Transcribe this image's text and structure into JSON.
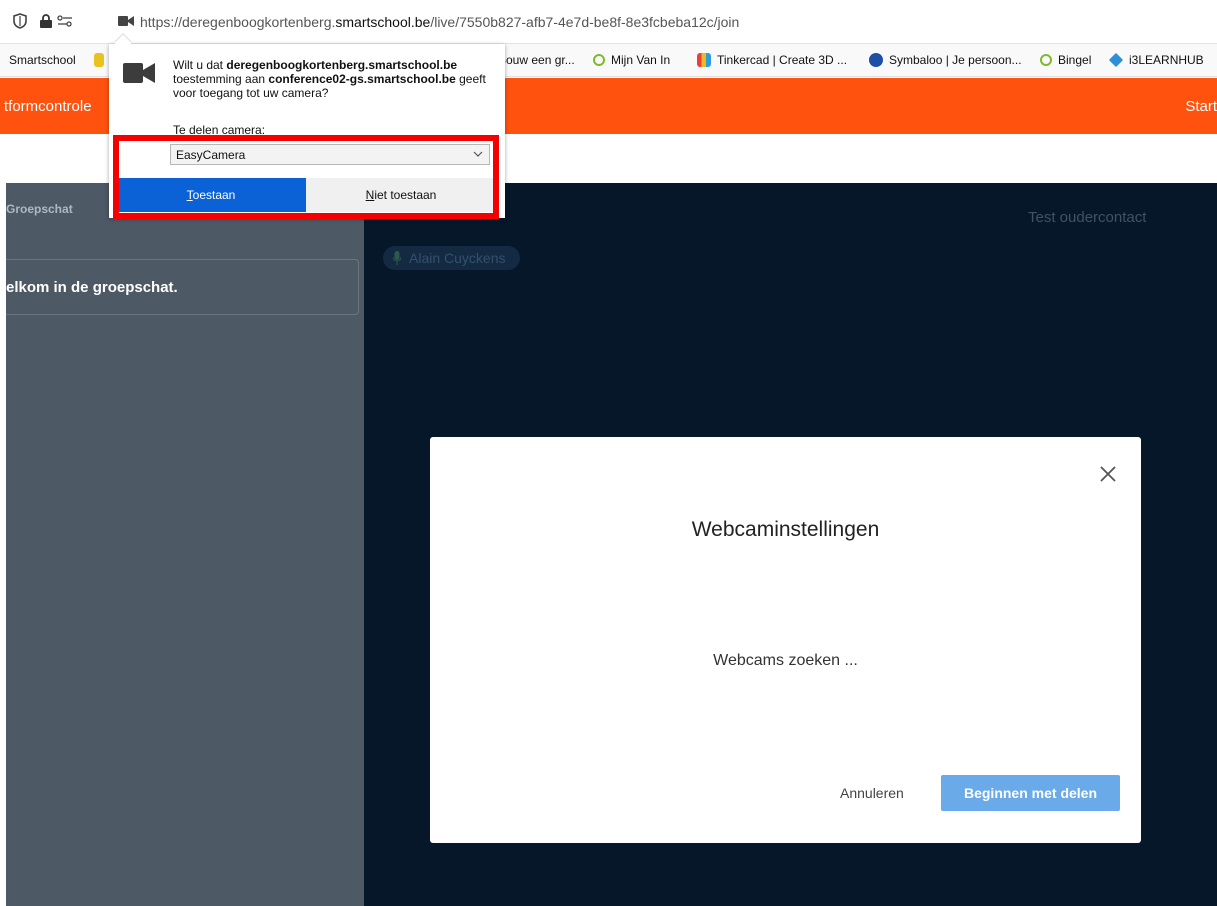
{
  "browser": {
    "url_prefix": "https://deregenboogkortenberg.",
    "url_domain": "smartschool.be",
    "url_path": "/live/7550b827-afb7-4e7d-be8f-8e3fcbeba12c/join"
  },
  "bookmarks": [
    {
      "label": "Smartschool",
      "icon": "none"
    },
    {
      "label": "Bouw een gr...",
      "icon": "none"
    },
    {
      "label": "Mijn Van In",
      "icon": "book-icon",
      "color": "#7fba2c"
    },
    {
      "label": "Tinkercad | Create 3D ...",
      "icon": "tinkercad-icon",
      "color": "#e8413a"
    },
    {
      "label": "Symbaloo | Je persoon...",
      "icon": "symbaloo-icon",
      "color": "#1d4fa6"
    },
    {
      "label": "Bingel",
      "icon": "book-icon",
      "color": "#7fba2c"
    },
    {
      "label": "i3LEARNHUB",
      "icon": "diamond-icon",
      "color": "#2d8fd5"
    }
  ],
  "header": {
    "left_text": "tformcontrole",
    "right_text": "Start",
    "color": "#ff520e"
  },
  "chat": {
    "title": "Groepschat",
    "welcome": "elkom in de groepschat."
  },
  "main": {
    "test_label": "Test oudercontact",
    "participant": "Alain Cuyckens"
  },
  "permission_popup": {
    "msg_prefix": "Wilt u dat ",
    "site": "deregenboogkortenberg.smartschool.be",
    "msg_middle": " toestemming aan ",
    "target": "conference02-gs.smartschool.be",
    "msg_suffix": " geeft voor toegang tot uw camera?",
    "share_label_u": "T",
    "share_label_rest": "e delen camera:",
    "selected_camera": "EasyCamera",
    "allow_u": "T",
    "allow_rest": "oestaan",
    "deny_u": "N",
    "deny_rest": "iet toestaan"
  },
  "webcam_modal": {
    "title": "Webcaminstellingen",
    "status": "Webcams zoeken ...",
    "cancel_label": "Annuleren",
    "start_label": "Beginnen met delen"
  }
}
